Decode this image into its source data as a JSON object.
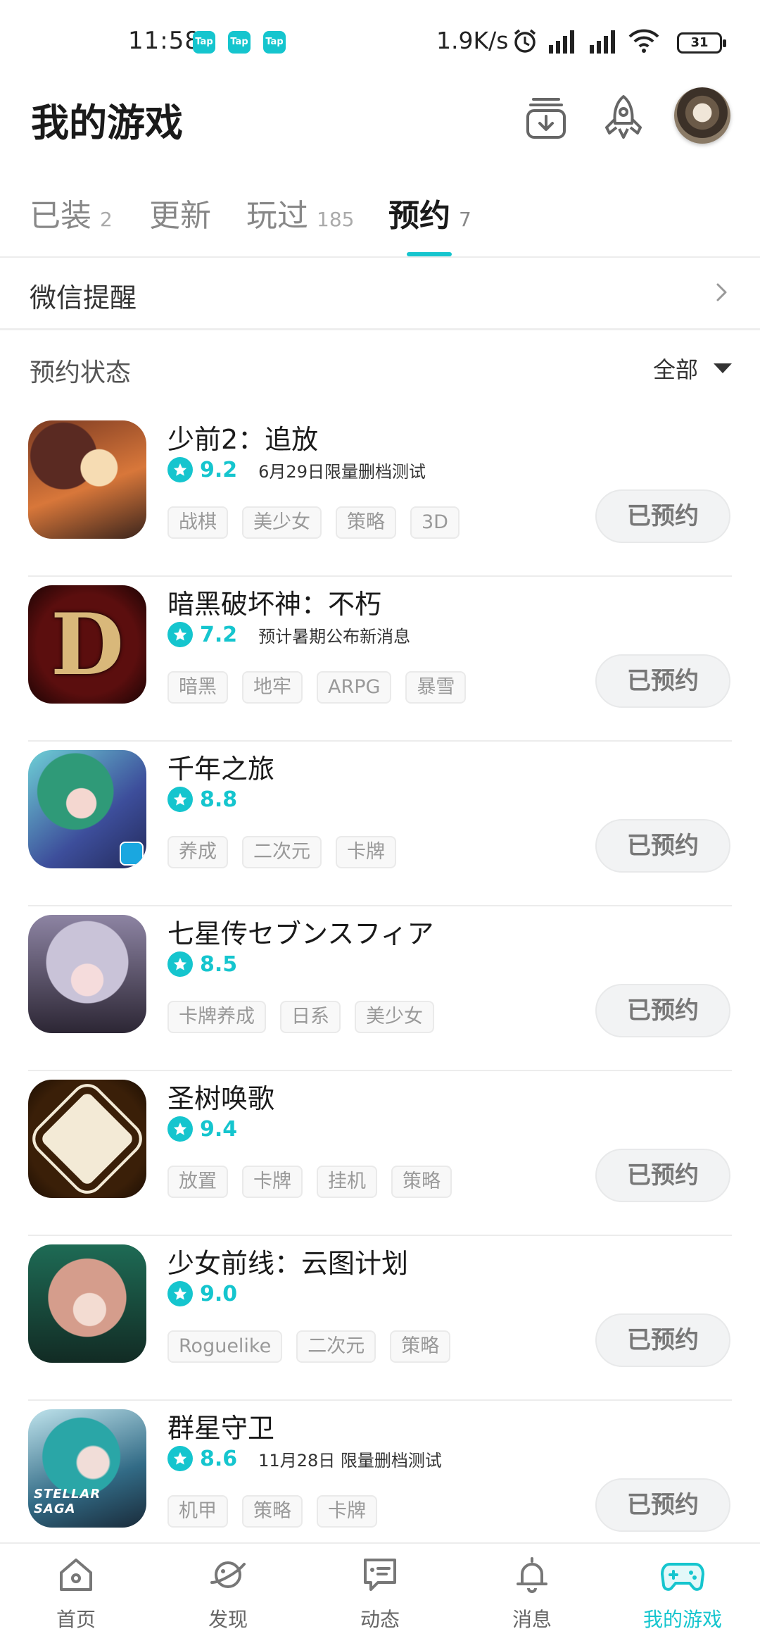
{
  "status_bar": {
    "time": "11:58",
    "notif_badges": [
      "Tap",
      "Tap",
      "Tap"
    ],
    "net_speed": "1.9K/s",
    "battery": "31"
  },
  "header": {
    "title": "我的游戏",
    "icons": [
      "download-manager-icon",
      "rocket-icon",
      "avatar"
    ]
  },
  "tabs": [
    {
      "label": "已装",
      "count": "2"
    },
    {
      "label": "更新",
      "count": ""
    },
    {
      "label": "玩过",
      "count": "185"
    },
    {
      "label": "预约",
      "count": "7"
    }
  ],
  "active_tab": "预约",
  "wechat_reminder": {
    "label": "微信提醒"
  },
  "filter": {
    "label": "预约状态",
    "selected": "全部"
  },
  "games": [
    {
      "name": "少前2：追放",
      "rating": "9.2",
      "note": "6月29日限量删档测试",
      "tags": [
        "战棋",
        "美少女",
        "策略",
        "3D"
      ],
      "action": "已预约"
    },
    {
      "name": "暗黑破坏神：不朽",
      "rating": "7.2",
      "note": "预计暑期公布新消息",
      "tags": [
        "暗黑",
        "地牢",
        "ARPG",
        "暴雪"
      ],
      "action": "已预约",
      "thumb_letter": "D"
    },
    {
      "name": "千年之旅",
      "rating": "8.8",
      "note": "",
      "tags": [
        "养成",
        "二次元",
        "卡牌"
      ],
      "action": "已预约"
    },
    {
      "name": "七星传セブンスフィア",
      "rating": "8.5",
      "note": "",
      "tags": [
        "卡牌养成",
        "日系",
        "美少女"
      ],
      "action": "已预约"
    },
    {
      "name": "圣树唤歌",
      "rating": "9.4",
      "note": "",
      "tags": [
        "放置",
        "卡牌",
        "挂机",
        "策略"
      ],
      "action": "已预约"
    },
    {
      "name": "少女前线：云图计划",
      "rating": "9.0",
      "note": "",
      "tags": [
        "Roguelike",
        "二次元",
        "策略"
      ],
      "action": "已预约"
    },
    {
      "name": "群星守卫",
      "rating": "8.6",
      "note": "11月28日 限量删档测试",
      "tags": [
        "机甲",
        "策略",
        "卡牌"
      ],
      "action": "已预约",
      "thumb_text": "STELLAR SAGA"
    }
  ],
  "bottom_nav": [
    {
      "label": "首页",
      "icon": "home-icon"
    },
    {
      "label": "发现",
      "icon": "planet-icon"
    },
    {
      "label": "动态",
      "icon": "chat-icon"
    },
    {
      "label": "消息",
      "icon": "bell-icon"
    },
    {
      "label": "我的游戏",
      "icon": "gamepad-icon"
    }
  ],
  "colors": {
    "accent": "#15c5ce",
    "text": "#1a1a1a",
    "muted": "#888888"
  }
}
